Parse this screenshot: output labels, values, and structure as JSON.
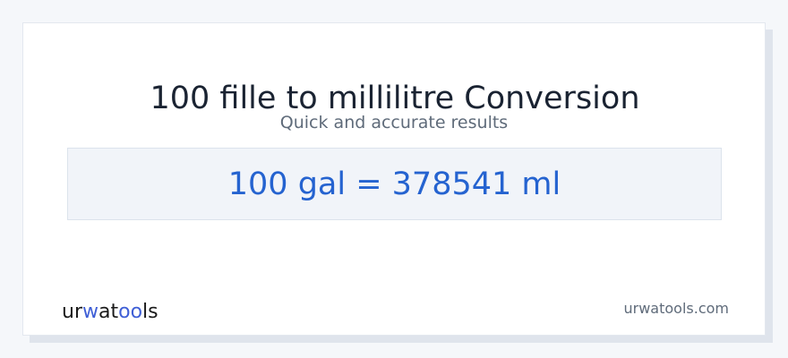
{
  "card": {
    "title": "100 fille to millilitre Conversion",
    "subtitle": "Quick and accurate results",
    "result": "100 gal = 378541 ml"
  },
  "footer": {
    "logo_text_start": "ur",
    "logo_text_accent": "w",
    "logo_text_mid": "at",
    "logo_text_accent2": "oo",
    "logo_text_end": "ls",
    "site_url": "urwatools.com"
  },
  "colors": {
    "accent": "#2563d0",
    "logo_accent": "#3f5fd6"
  }
}
